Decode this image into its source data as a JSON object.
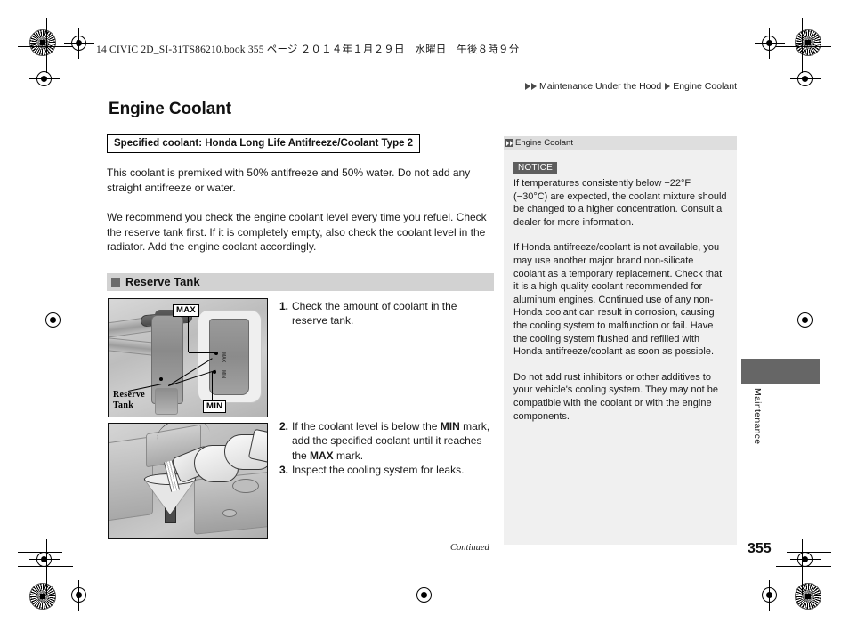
{
  "running_head": "14 CIVIC 2D_SI-31TS86210.book   355 ページ   ２０１４年１月２９日　水曜日　午後８時９分",
  "breadcrumb": {
    "parent": "Maintenance Under the Hood",
    "current": "Engine Coolant"
  },
  "main": {
    "title": "Engine Coolant",
    "spec_box": "Specified coolant: Honda Long Life Antifreeze/Coolant Type 2",
    "paragraph_1": "This coolant is premixed with 50% antifreeze and 50% water. Do not add any straight antifreeze or water.",
    "paragraph_2": "We recommend you check the engine coolant level every time you refuel. Check the reserve tank first. If it is completely empty, also check the coolant level in the radiator. Add the engine coolant accordingly.",
    "section_heading": "Reserve Tank",
    "steps": [
      {
        "num": "1.",
        "text": "Check the amount of coolant in the reserve tank."
      },
      {
        "num": "2.",
        "text_a": "If the coolant level is below the ",
        "bold_a": "MIN",
        "text_b": " mark, add the specified coolant until it reaches the ",
        "bold_b": "MAX",
        "text_c": " mark."
      },
      {
        "num": "3.",
        "text": "Inspect the cooling system for leaks."
      }
    ],
    "figure_1": {
      "label_max": "MAX",
      "label_min": "MIN",
      "label_reserve_line1": "Reserve",
      "label_reserve_line2": "Tank",
      "mark_max_small": "MAX",
      "mark_min_small": "MIN"
    }
  },
  "sidebar": {
    "header": "Engine Coolant",
    "notice_badge": "NOTICE",
    "notice_text": "If temperatures consistently below −22°F (−30°C) are expected, the coolant mixture should be changed to a higher concentration. Consult a dealer for more information.",
    "paragraph_2": "If Honda antifreeze/coolant is not available, you may use another major brand non-silicate coolant as a temporary replacement. Check that it is a high quality coolant recommended for aluminum engines. Continued use of any non-Honda coolant can result in corrosion, causing the cooling system to malfunction or fail. Have the cooling system flushed and refilled with Honda antifreeze/coolant as soon as possible.",
    "paragraph_3": "Do not add rust inhibitors or other additives to your vehicle's cooling system. They may not be compatible with the coolant or with the engine components."
  },
  "thumb_tab": {
    "label": "Maintenance"
  },
  "footer": {
    "continued": "Continued",
    "page_number": "355"
  },
  "colors": {
    "band_gray": "#d2d2d2",
    "sidebar_bg": "#f0f0f0",
    "sidebar_head": "#dedede",
    "notice_badge": "#5e5e5e",
    "tab_block": "#666666"
  }
}
